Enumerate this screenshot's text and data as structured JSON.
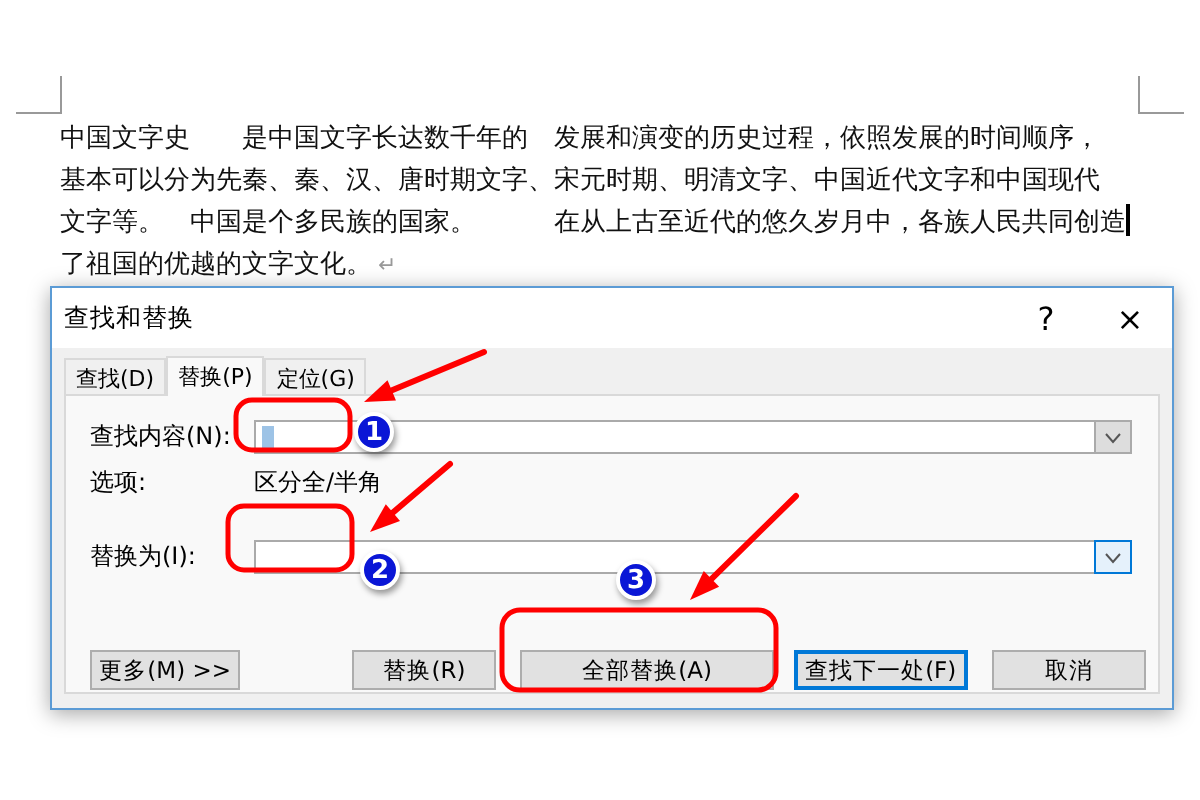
{
  "document": {
    "lines": [
      "中国文字史　　是中国文字长达数千年的　发展和演变的历史过程，依照发展的时间顺序，",
      "基本可以分为先秦、秦、汉、唐时期文字、宋元时期、明清文字、中国近代文字和中国现代",
      "文字等。　中国是个多民族的国家。　　　在从上古至近代的悠久岁月中，各族人民共同创造",
      "了祖国的优越的文字文化。"
    ],
    "paragraph_mark": "↵"
  },
  "dialog": {
    "title": "查找和替换",
    "help": "?",
    "close": "×",
    "tabs": [
      {
        "label": "查找(D)",
        "selected": false
      },
      {
        "label": "替换(P)",
        "selected": true
      },
      {
        "label": "定位(G)",
        "selected": false
      }
    ],
    "find": {
      "label": "查找内容(N):",
      "focused": false
    },
    "options": {
      "label": "选项:",
      "value": "区分全/半角"
    },
    "replace": {
      "label": "替换为(I):",
      "focused": true
    },
    "buttons": [
      {
        "label": "更多(M) >>",
        "default": false
      },
      {
        "label": "替换(R)",
        "default": false
      },
      {
        "label": "全部替换(A)",
        "default": false
      },
      {
        "label": "查找下一处(F)",
        "default": true
      },
      {
        "label": "取消",
        "default": false
      }
    ]
  },
  "annotations": [
    "1",
    "2",
    "3"
  ]
}
